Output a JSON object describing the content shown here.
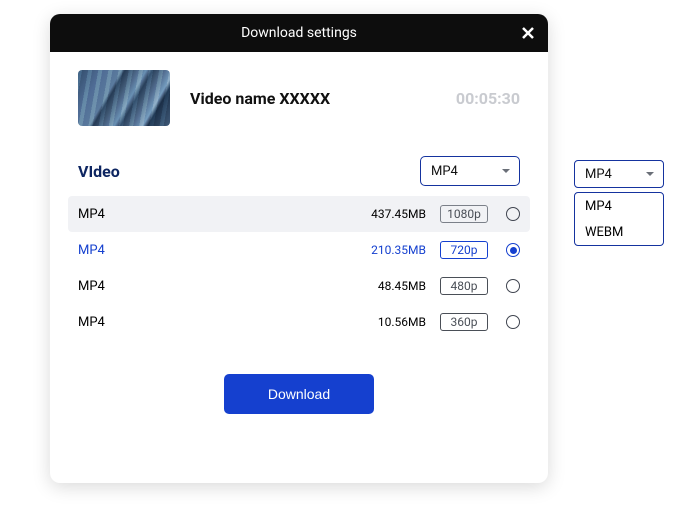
{
  "modal": {
    "title": "Download settings",
    "video_name": "Video name XXXXX",
    "duration": "00:05:30",
    "section_label": "VIdeo",
    "format_select": {
      "selected": "MP4",
      "options": [
        "MP4",
        "WEBM"
      ]
    },
    "rows": [
      {
        "format": "MP4",
        "size": "437.45MB",
        "quality": "1080p",
        "state": "hover"
      },
      {
        "format": "MP4",
        "size": "210.35MB",
        "quality": "720p",
        "state": "selected"
      },
      {
        "format": "MP4",
        "size": "48.45MB",
        "quality": "480p",
        "state": "normal"
      },
      {
        "format": "MP4",
        "size": "10.56MB",
        "quality": "360p",
        "state": "normal"
      }
    ],
    "download_label": "Download"
  },
  "dropdown_popup": {
    "selected": "MP4",
    "options": [
      "MP4",
      "WEBM"
    ]
  }
}
